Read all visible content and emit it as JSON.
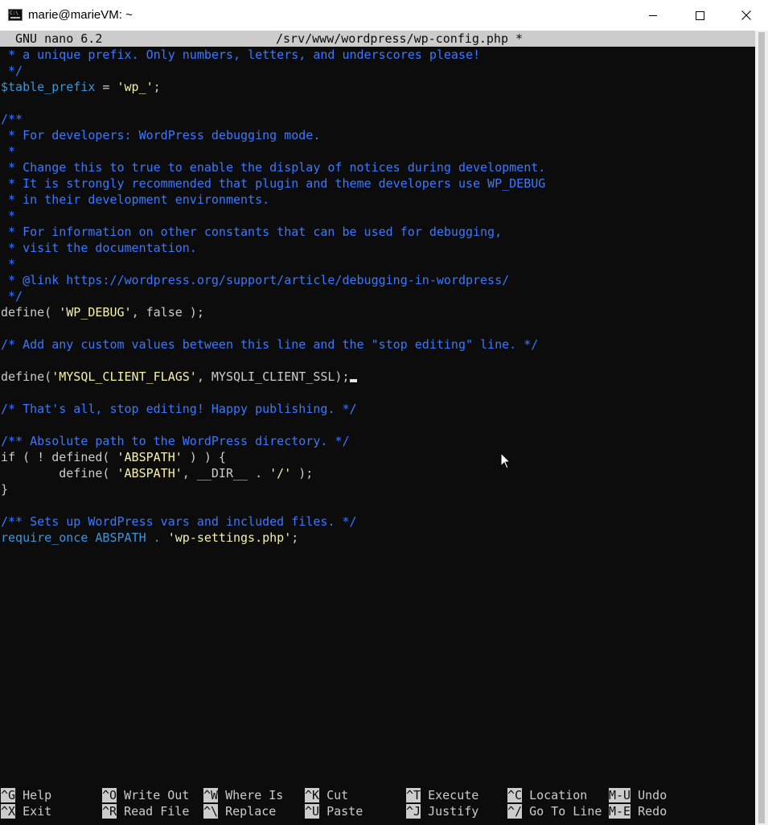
{
  "window": {
    "title": "marie@marieVM: ~",
    "minimize_icon": "minimize-icon",
    "maximize_icon": "maximize-icon",
    "close_icon": "close-icon"
  },
  "nano": {
    "version": "GNU nano 6.2",
    "filename": "/srv/www/wordpress/wp-config.php *"
  },
  "editor": {
    "lines": [
      " * a unique prefix. Only numbers, letters, and underscores please!",
      " */",
      "$table_prefix",
      " = ",
      "'wp_'",
      ";",
      "",
      "/**",
      " * For developers: WordPress debugging mode.",
      " *",
      " * Change this to true to enable the display of notices during development.",
      " * It is strongly recommended that plugin and theme developers use WP_DEBUG",
      " * in their development environments.",
      " *",
      " * For information on other constants that can be used for debugging,",
      " * visit the documentation.",
      " *",
      " * @link https://wordpress.org/support/article/debugging-in-wordpress/",
      " */",
      "define( ",
      "'WP_DEBUG'",
      ", false );",
      "/* Add any custom values between this line and the \"stop editing\" line. */",
      "define(",
      "'MYSQL_CLIENT_FLAGS'",
      ", MYSQLI_CLIENT_SSL);",
      "/* That's all, stop editing! Happy publishing. */",
      "/** Absolute path to the WordPress directory. */",
      "if ( ! defined( ",
      "'ABSPATH'",
      " ) ) {",
      "        define( ",
      "'ABSPATH'",
      ", __DIR__ . ",
      "'/'",
      " );",
      "}",
      "/** Sets up WordPress vars and included files. */",
      "require_once ABSPATH . ",
      "'wp-settings.php'",
      ";"
    ]
  },
  "shortcuts": [
    {
      "key": "^G",
      "label": "Help"
    },
    {
      "key": "^O",
      "label": "Write Out"
    },
    {
      "key": "^W",
      "label": "Where Is"
    },
    {
      "key": "^K",
      "label": "Cut"
    },
    {
      "key": "^T",
      "label": "Execute"
    },
    {
      "key": "^C",
      "label": "Location"
    },
    {
      "key": "M-U",
      "label": "Undo"
    },
    {
      "key": "^X",
      "label": "Exit"
    },
    {
      "key": "^R",
      "label": "Read File"
    },
    {
      "key": "^\\",
      "label": "Replace"
    },
    {
      "key": "^U",
      "label": "Paste"
    },
    {
      "key": "^J",
      "label": "Justify"
    },
    {
      "key": "^/",
      "label": "Go To Line"
    },
    {
      "key": "M-E",
      "label": "Redo"
    }
  ],
  "colors": {
    "comment": "#3b78ff",
    "variable": "#3a96dd",
    "string": "#f9f1a5",
    "text": "#cccccc",
    "background": "#0c0c0c",
    "header_bg": "#cccccc"
  }
}
